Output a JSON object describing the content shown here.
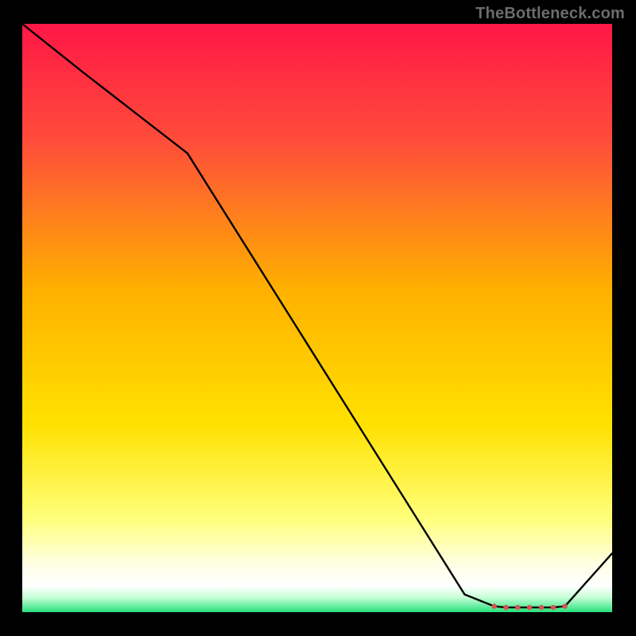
{
  "watermark": "TheBottleneck.com",
  "colors": {
    "top": "#ff1746",
    "mid_upper": "#ff6a2a",
    "mid": "#ffd600",
    "pale": "#ffffaa",
    "white": "#ffffff",
    "green": "#27e07e",
    "line": "#000000",
    "marker": "#d9534f",
    "background": "#000000"
  },
  "chart_data": {
    "type": "line",
    "title": "",
    "xlabel": "",
    "ylabel": "",
    "xlim": [
      0,
      100
    ],
    "ylim": [
      0,
      100
    ],
    "x": [
      0,
      10,
      28,
      75,
      80,
      82,
      84,
      86,
      88,
      90,
      92,
      100
    ],
    "y": [
      100,
      92,
      78,
      3,
      1,
      0.8,
      0.8,
      0.8,
      0.8,
      0.8,
      1,
      10
    ],
    "markers": {
      "x": [
        80,
        82,
        84,
        86,
        88,
        90,
        92
      ],
      "y": [
        1,
        0.8,
        0.8,
        0.8,
        0.8,
        0.8,
        1
      ]
    }
  }
}
